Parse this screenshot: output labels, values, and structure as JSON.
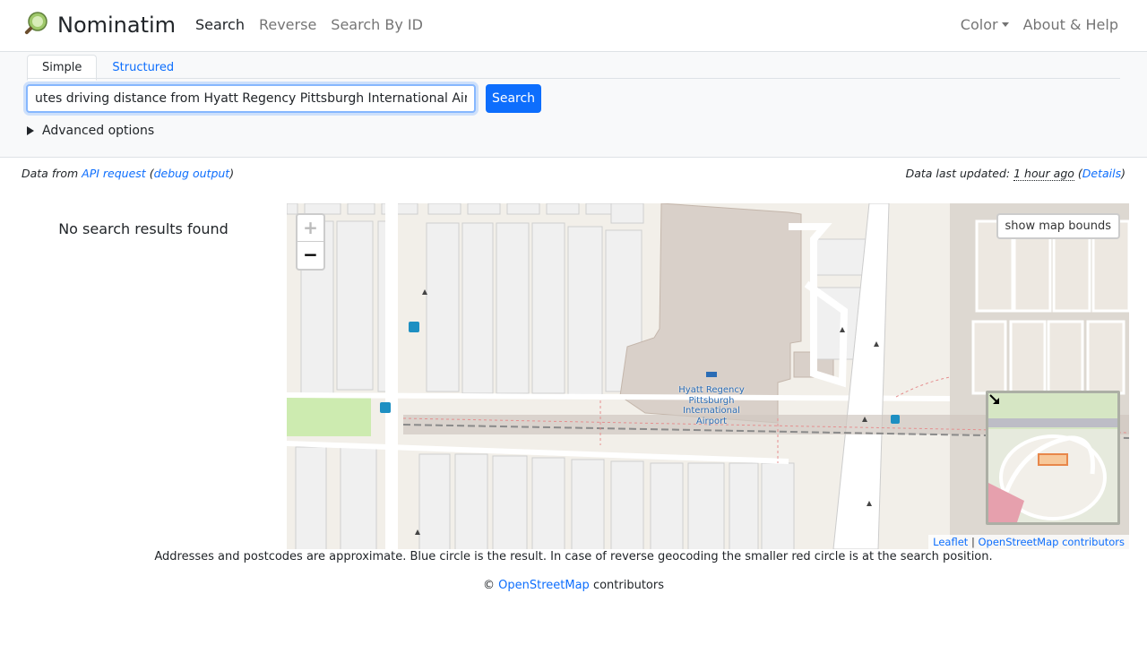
{
  "header": {
    "brand": "Nominatim",
    "nav": [
      {
        "label": "Search"
      },
      {
        "label": "Reverse"
      },
      {
        "label": "Search By ID"
      }
    ],
    "right": {
      "color_label": "Color",
      "about_label": "About & Help"
    }
  },
  "search": {
    "tabs": [
      {
        "label": "Simple"
      },
      {
        "label": "Structured"
      }
    ],
    "query_value": "utes driving distance from Hyatt Regency Pittsburgh International Airport",
    "button_label": "Search",
    "advanced_label": "Advanced options"
  },
  "data_info": {
    "prefix": "Data from ",
    "api_link": "API request",
    "debug_link": "debug output",
    "updated_prefix": "Data last updated: ",
    "updated_value": "1 hour ago",
    "details_link": "Details"
  },
  "results": {
    "empty_message": "No search results found"
  },
  "map": {
    "zoom_in": "+",
    "zoom_out": "−",
    "bounds_button": "show map bounds",
    "poi_name": "Hyatt Regency Pittsburgh International Airport",
    "attribution_leaflet": "Leaflet",
    "attribution_osm": "OpenStreetMap contributors",
    "minimap_expand_icon": "arrow-expand-icon"
  },
  "footer": {
    "note": "Addresses and postcodes are approximate. Blue circle is the result. In case of reverse geocoding the smaller red circle is at the search position.",
    "copyright_symbol": "©",
    "osm_link": "OpenStreetMap",
    "contributors": " contributors"
  },
  "colors": {
    "accent": "#0d6efd",
    "map_bg": "#f2efe9",
    "building": "#d9d0c9",
    "park": "#c8facc"
  }
}
